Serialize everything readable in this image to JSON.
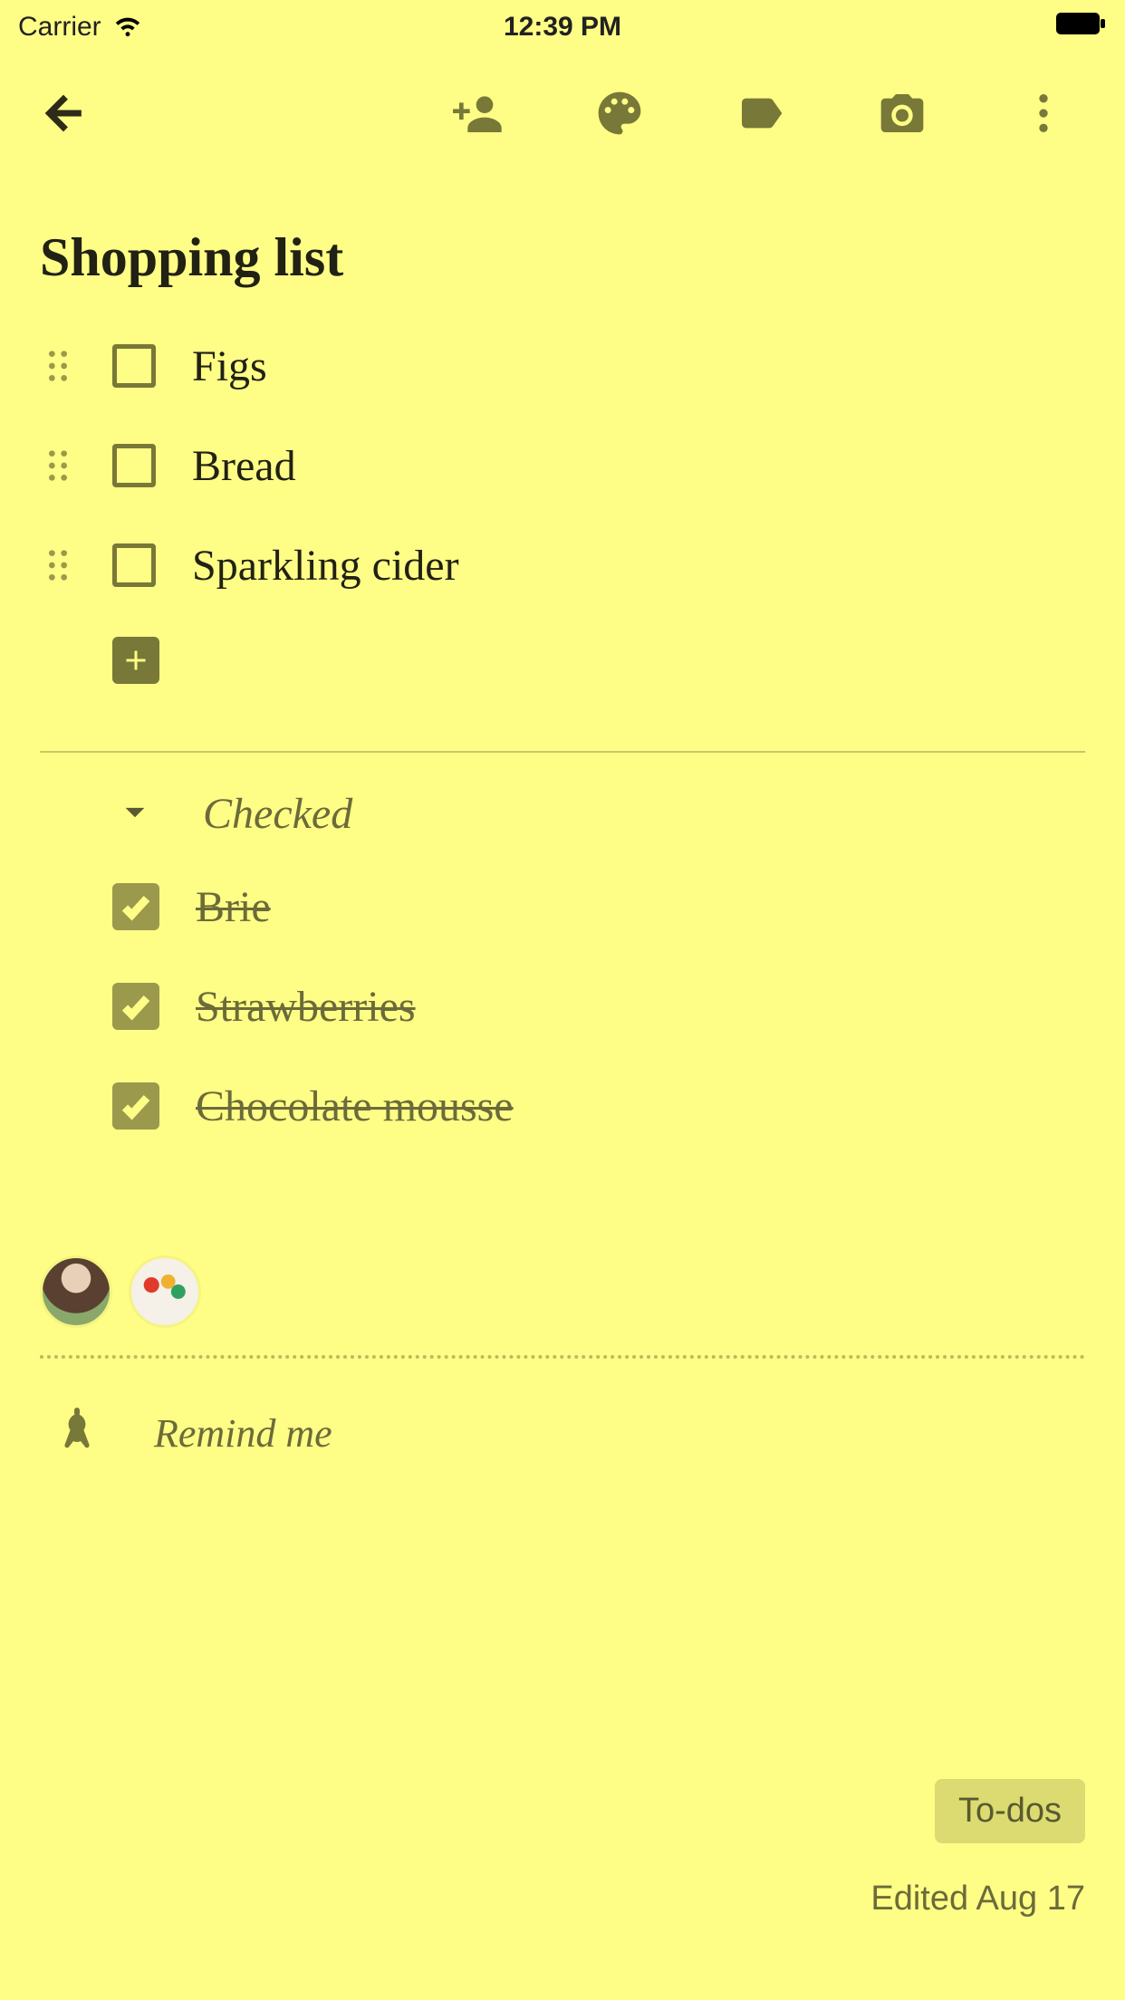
{
  "status": {
    "carrier": "Carrier",
    "time": "12:39 PM"
  },
  "note": {
    "title": "Shopping list",
    "unchecked": [
      {
        "text": "Figs"
      },
      {
        "text": "Bread"
      },
      {
        "text": "Sparkling cider"
      }
    ],
    "checked_header": "Checked",
    "checked": [
      {
        "text": "Brie"
      },
      {
        "text": "Strawberries"
      },
      {
        "text": "Chocolate mousse"
      }
    ]
  },
  "remind": {
    "label": "Remind me"
  },
  "footer": {
    "tag": "To-dos",
    "edited": "Edited Aug 17"
  },
  "colors": {
    "background": "#FEFD86",
    "accent": "#787838"
  }
}
